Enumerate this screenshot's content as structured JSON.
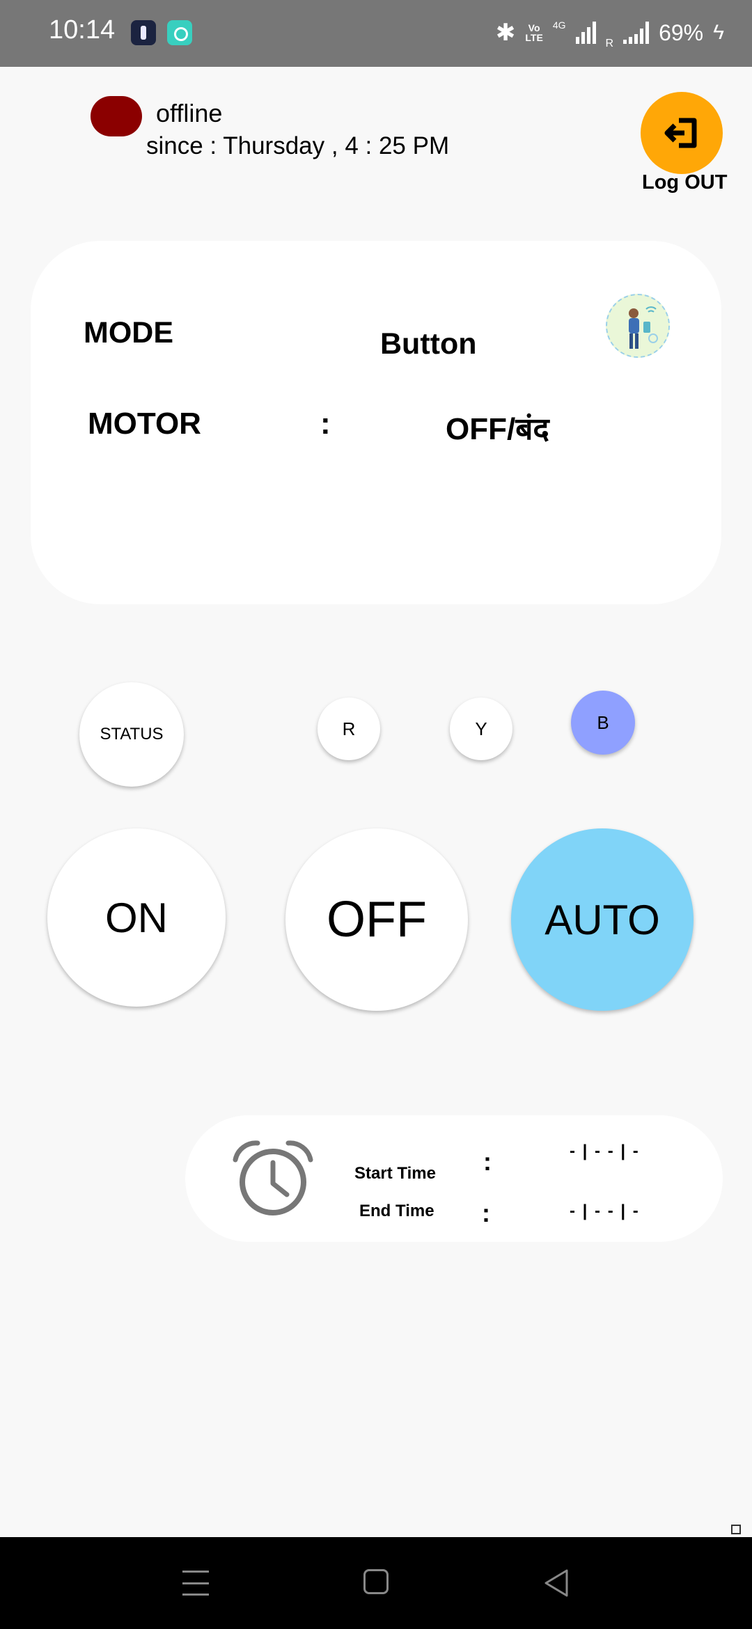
{
  "status_bar": {
    "time": "10:14",
    "network_label": "4G",
    "volte_top": "Vo",
    "volte_bottom": "LTE",
    "roaming": "R",
    "battery": "69%"
  },
  "connection": {
    "state": "offline",
    "since": "since : Thursday , 4 : 25 PM",
    "indicator_color": "#8b0000"
  },
  "logout": {
    "label": "Log OUT",
    "color": "#ffa707"
  },
  "mode_card": {
    "mode_label": "MODE",
    "mode_value": "Button",
    "motor_label": "MOTOR",
    "separator": ":",
    "motor_value": "OFF/बंद"
  },
  "phases": {
    "status": "STATUS",
    "r": "R",
    "y": "Y",
    "b": "B",
    "b_color": "#8fa0ff"
  },
  "controls": {
    "on": "ON",
    "off": "OFF",
    "auto": "AUTO",
    "auto_color": "#80d4f8"
  },
  "timer": {
    "start_label": "Start Time",
    "end_label": "End Time",
    "separator": ":",
    "start_value": "- | - - | -",
    "end_value": "- | - - | -"
  },
  "icons": [
    "logout-icon",
    "alarm-clock-icon",
    "menu-icon",
    "home-icon",
    "back-icon",
    "bluetooth-icon",
    "signal-icon",
    "battery-charging-icon"
  ]
}
